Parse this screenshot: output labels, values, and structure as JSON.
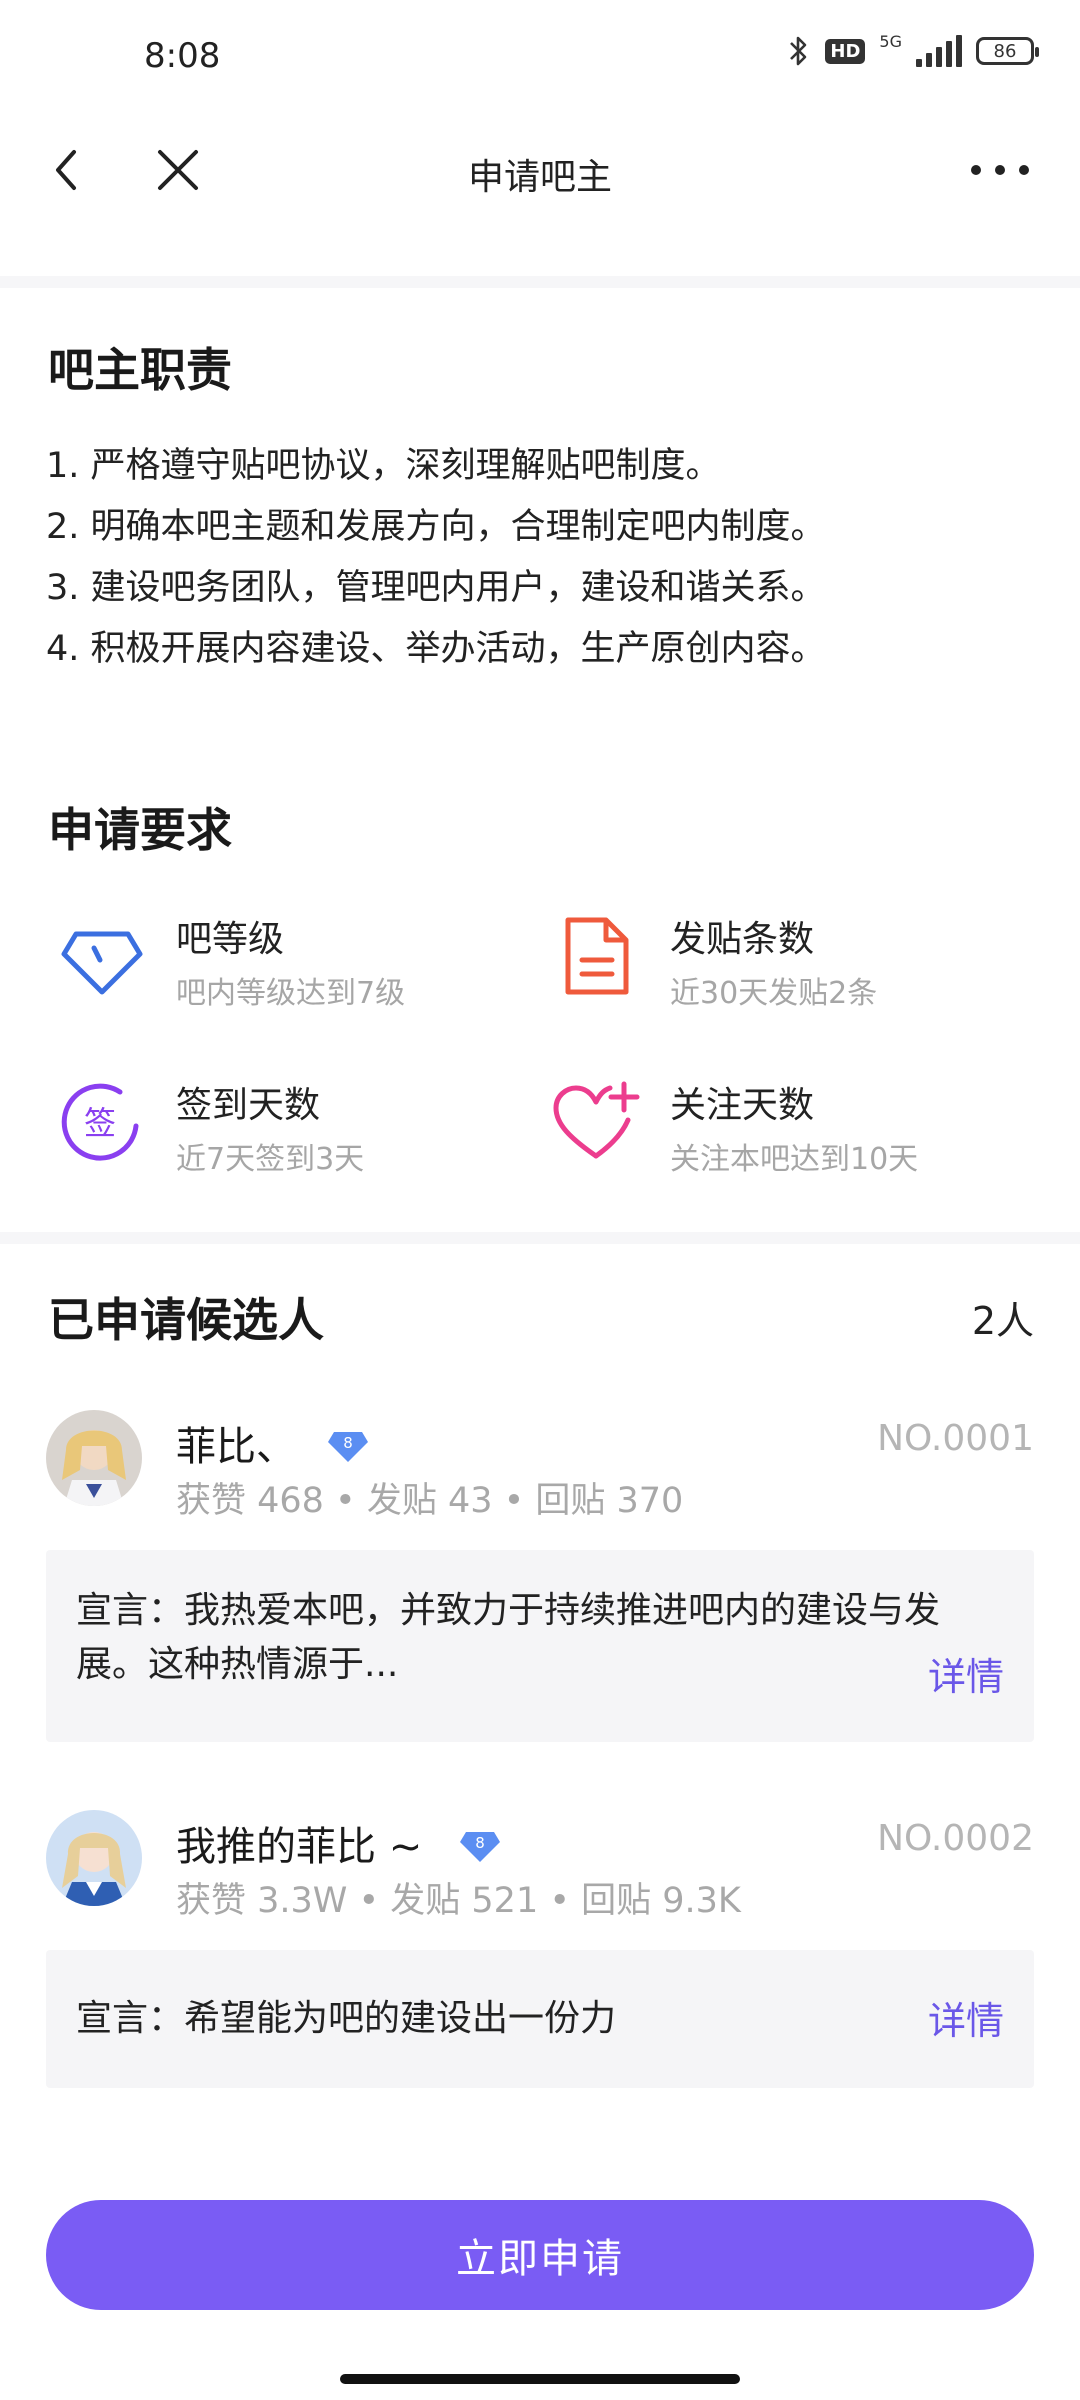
{
  "status": {
    "time": "8:08",
    "network": "5G",
    "hd": "HD",
    "battery": "86"
  },
  "nav": {
    "title": "申请吧主"
  },
  "duties": {
    "title": "吧主职责",
    "items": [
      "1. 严格遵守贴吧协议，深刻理解贴吧制度。",
      "2. 明确本吧主题和发展方向，合理制定吧内制度。",
      "3. 建设吧务团队，管理吧内用户，建设和谐关系。",
      "4. 积极开展内容建设、举办活动，生产原创内容。"
    ]
  },
  "requirements": {
    "title": "申请要求",
    "items": [
      {
        "title": "吧等级",
        "desc": "吧内等级达到7级",
        "icon": "diamond-icon",
        "color": "#3b6fe0"
      },
      {
        "title": "发贴条数",
        "desc": "近30天发贴2条",
        "icon": "document-icon",
        "color": "#ef5a3c"
      },
      {
        "title": "签到天数",
        "desc": "近7天签到3天",
        "icon": "sign-in-icon",
        "color": "#8a3ff0"
      },
      {
        "title": "关注天数",
        "desc": "关注本吧达到10天",
        "icon": "heart-plus-icon",
        "color": "#ec3d8e"
      }
    ]
  },
  "candidates": {
    "title": "已申请候选人",
    "count": "2人",
    "items": [
      {
        "name": "菲比、",
        "level": "8",
        "no": "NO.0001",
        "stats": "获赞 468 • 发贴 43 • 回贴 370",
        "declaration": "宣言：我热爱本吧，并致力于持续推进吧内的建设与发展。这种热情源于...",
        "more": "详情"
      },
      {
        "name": "我推的菲比 ~",
        "level": "8",
        "no": "NO.0002",
        "stats": "获赞 3.3W • 发贴 521 • 回贴 9.3K",
        "declaration": "宣言：希望能为吧的建设出一份力",
        "more": "详情"
      }
    ]
  },
  "apply_button": "立即申请",
  "colors": {
    "accent": "#7a5cf4",
    "link": "#6a57e8"
  }
}
